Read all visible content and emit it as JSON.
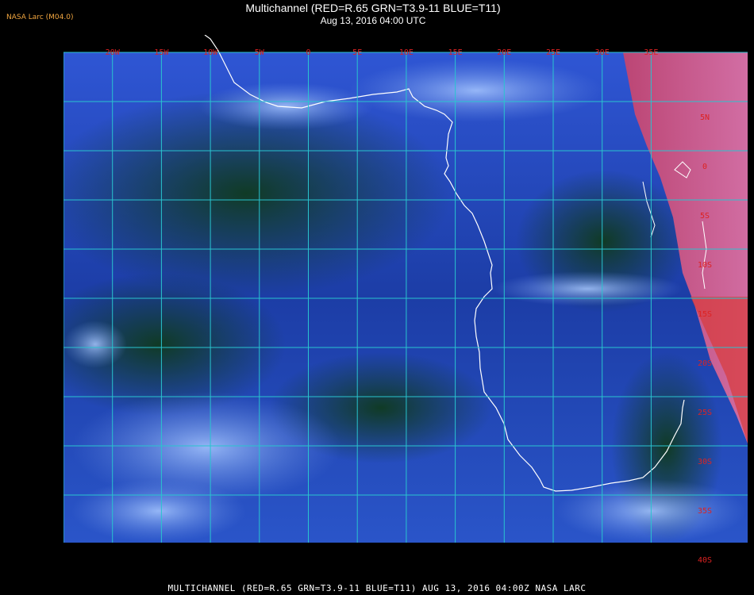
{
  "header": {
    "credit": "NASA Larc (M04.0)",
    "title": "Multichannel (RED=R.65 GRN=T3.9-11 BLUE=T11)",
    "subtitle": "Aug 13, 2016 04:00 UTC"
  },
  "footer": {
    "text": "MULTICHANNEL (RED=R.65 GRN=T3.9-11 BLUE=T11) AUG 13, 2016 04:00Z   NASA LARC"
  },
  "map": {
    "lon_labels": [
      "25W",
      "20W",
      "15W",
      "10W",
      "5W",
      "0",
      "5E",
      "10E",
      "15E",
      "20E",
      "25E",
      "30E",
      "35E"
    ],
    "lat_labels": [
      "5N",
      "0",
      "5S",
      "10S",
      "15S",
      "20S",
      "25S",
      "30S",
      "35S",
      "40S"
    ],
    "colors": {
      "grid": "#29c4cf",
      "label": "#cc2222",
      "coast": "#ffffff",
      "ocean": "#1d3fa8",
      "land_vegetated": "#123a26",
      "land_dry": "#d24a72"
    }
  }
}
